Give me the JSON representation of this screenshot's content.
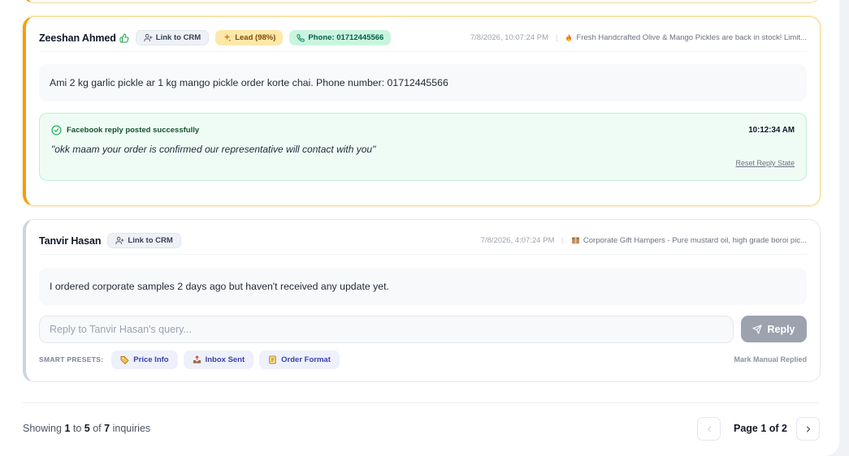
{
  "inquiries": [
    {
      "author": "Zeeshan Ahmed",
      "link_crm_label": "Link to CRM",
      "lead_badge": "Lead (98%)",
      "phone_badge": "Phone: 01712445566",
      "timestamp": "7/8/2026, 10:07:24 PM",
      "post_title": "Fresh Handcrafted Olive & Mango Pickles are back in stock! Limit...",
      "message": "Ami 2 kg garlic pickle ar 1 kg mango pickle order korte chai. Phone number: 01712445566",
      "reply": {
        "status": "Facebook reply posted successfully",
        "time": "10:12:34 AM",
        "text": "\"okk maam your order is confirmed our representative will contact with you\"",
        "reset_label": "Reset Reply State"
      }
    },
    {
      "author": "Tanvir Hasan",
      "link_crm_label": "Link to CRM",
      "timestamp": "7/8/2026, 4:07:24 PM",
      "post_title": "Corporate Gift Hampers - Pure mustard oil, high grade boroi pic...",
      "message": "I ordered corporate samples 2 days ago but haven't received any update yet.",
      "reply_placeholder": "Reply to Tanvir Hasan's query...",
      "reply_button": "Reply",
      "presets_label": "SMART PRESETS:",
      "presets": [
        "Price Info",
        "Inbox Sent",
        "Order Format"
      ],
      "mark_manual": "Mark Manual Replied"
    }
  ],
  "pagination": {
    "showing_prefix": "Showing",
    "from": "1",
    "to_word": "to",
    "to": "5",
    "of_word": "of",
    "total": "7",
    "suffix": "inquiries",
    "page_label": "Page 1 of 2"
  },
  "colors": {
    "lead_accent": "#f59e0b",
    "success_green": "#16a34a",
    "preset_text": "#3b3fa8"
  }
}
